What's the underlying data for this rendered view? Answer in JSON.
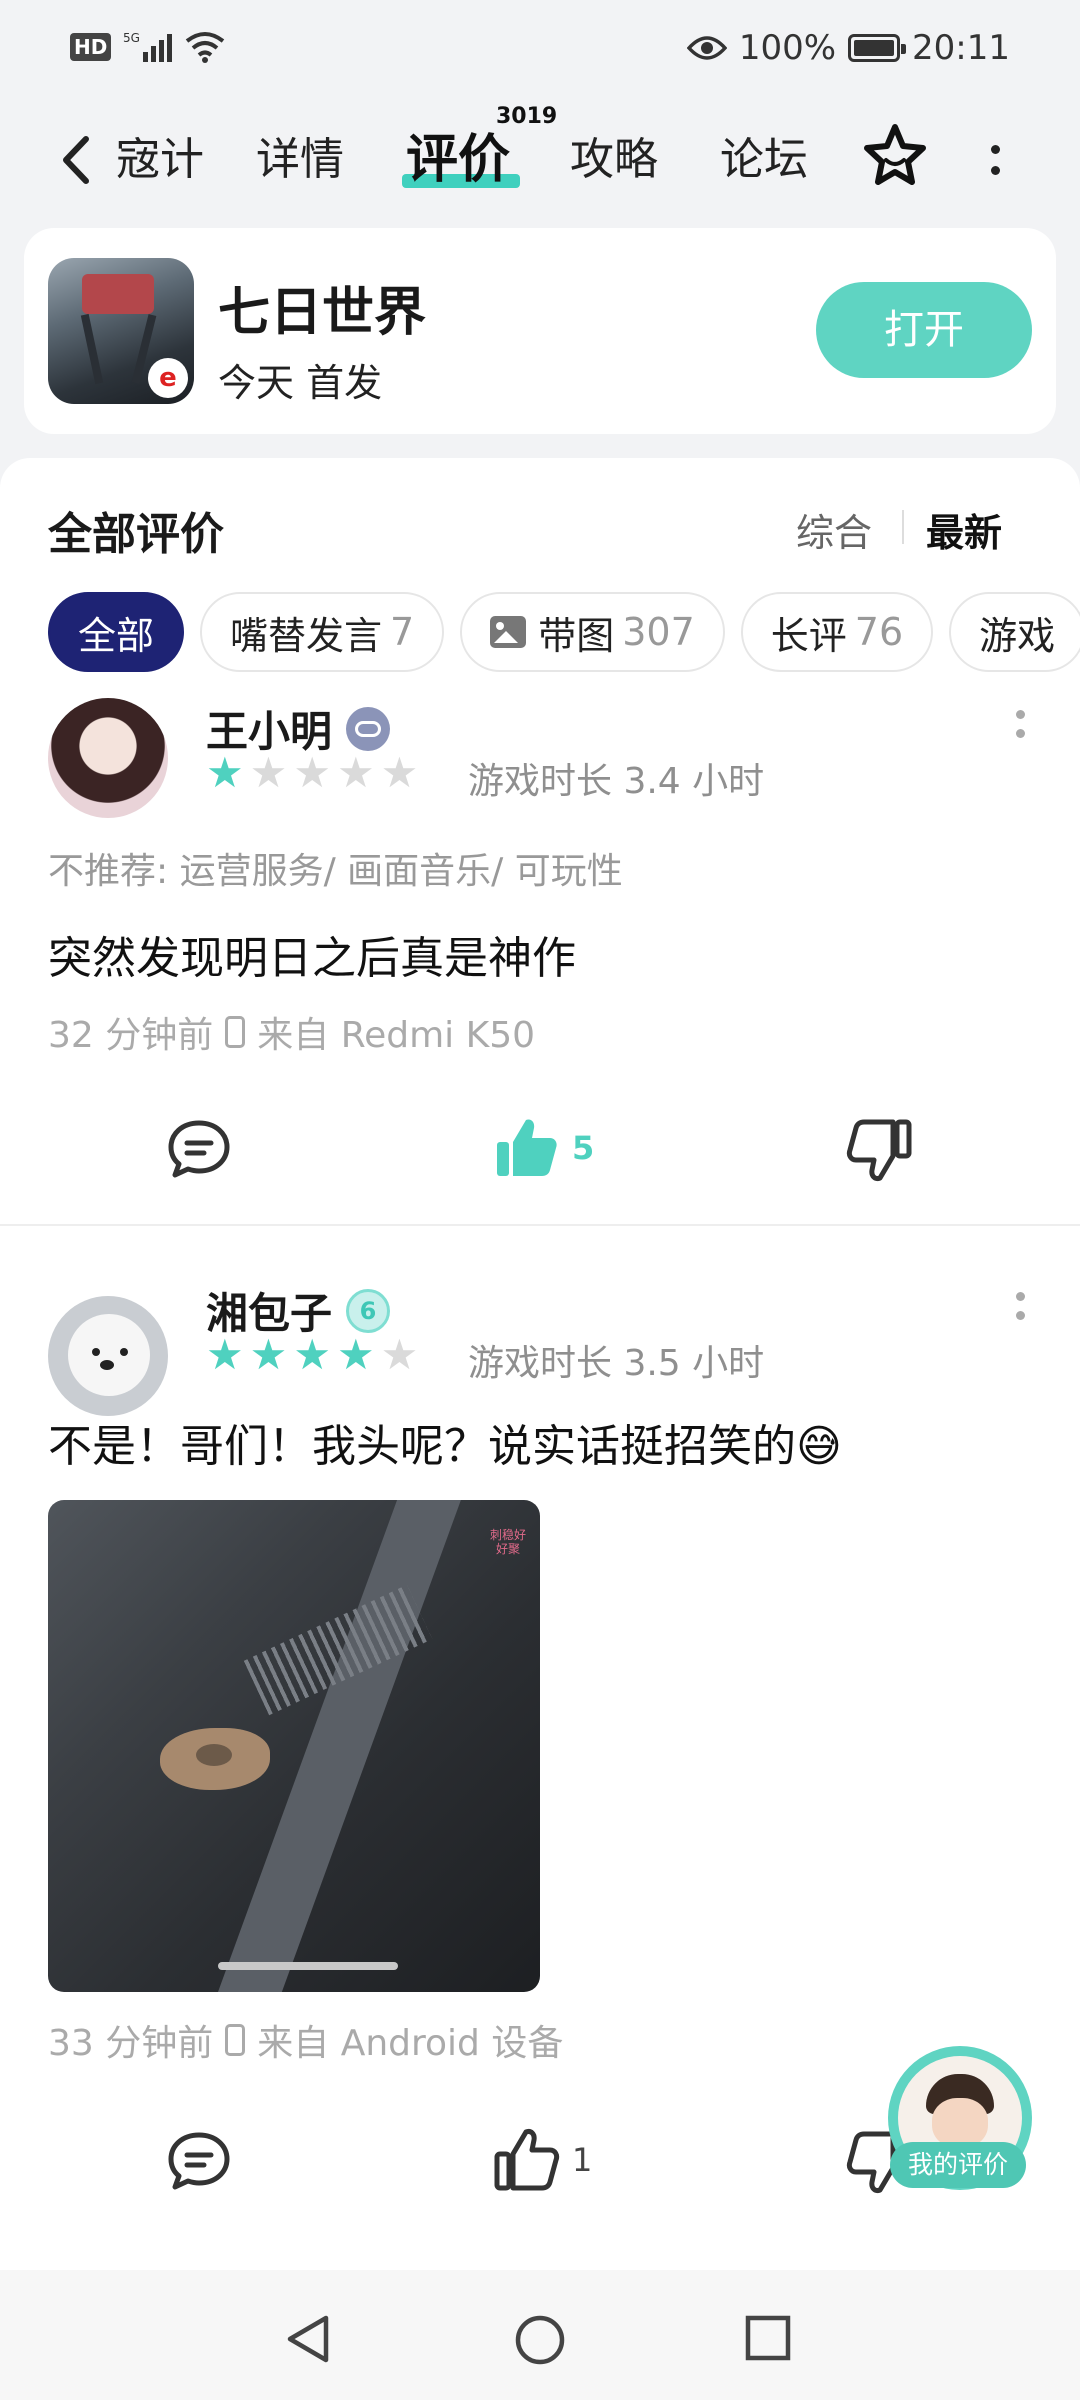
{
  "status_bar": {
    "hd": "HD",
    "network": "5G",
    "battery_percent": "100%",
    "battery_level": 1.0,
    "time": "20:11"
  },
  "nav": {
    "back_label": "宼计",
    "tabs": [
      {
        "label": "详情",
        "active": false
      },
      {
        "label": "评价",
        "active": true,
        "badge": "3019"
      },
      {
        "label": "攻略",
        "active": false
      },
      {
        "label": "论坛",
        "active": false
      }
    ]
  },
  "app": {
    "name": "七日世界",
    "subtitle": "今天 首发",
    "open_label": "打开"
  },
  "reviews_section": {
    "title": "全部评价",
    "sort_options": [
      "综合",
      "最新"
    ],
    "filters": [
      {
        "label": "全部",
        "count": "",
        "active": true
      },
      {
        "label": "嘴替发言",
        "count": "7",
        "active": false
      },
      {
        "label": "带图",
        "count": "307",
        "active": false,
        "icon": "image-icon"
      },
      {
        "label": "长评",
        "count": "76",
        "active": false
      },
      {
        "label": "游戏",
        "count": "",
        "active": false
      }
    ]
  },
  "reviews": [
    {
      "username": "王小明",
      "badge_icon": "gamepad-badge-icon",
      "rating": 1,
      "play_time": "游戏时长 3.4 小时",
      "tags": "不推荐: 运营服务/ 画面音乐/ 可玩性",
      "text": "突然发现明日之后真是神作",
      "time": "32 分钟前",
      "device": "来自 Redmi K50",
      "likes": "5",
      "liked": true
    },
    {
      "username": "湘包子",
      "badge_icon": "swirl-badge-icon",
      "rating": 4,
      "play_time": "游戏时长 3.5 小时",
      "text": "不是！哥们！我头呢？说实话挺招笑的😅",
      "photo_overlay": "刺稳好\n好聚",
      "time": "33 分钟前",
      "device": "来自 Android 设备",
      "likes": "1",
      "liked": false
    }
  ],
  "my_review": {
    "label": "我的评价"
  },
  "colors": {
    "accent": "#4fd1bf",
    "active_chip": "#1e2374",
    "open_button": "#5fd4c2"
  }
}
